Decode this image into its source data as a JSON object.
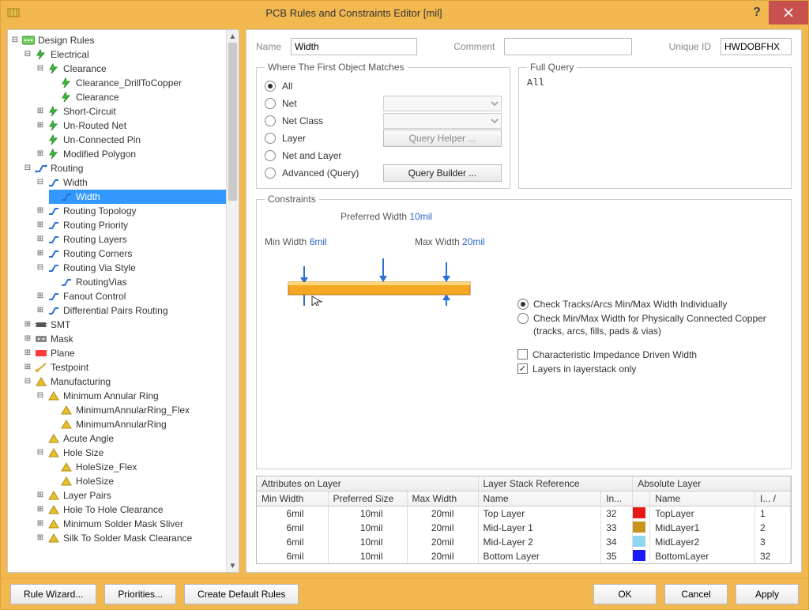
{
  "window": {
    "title": "PCB Rules and Constraints Editor [mil]"
  },
  "tree": {
    "root": "Design Rules",
    "electrical": {
      "label": "Electrical",
      "clearance_group": "Clearance",
      "clearance_drill": "Clearance_DrillToCopper",
      "clearance": "Clearance",
      "short_circuit": "Short-Circuit",
      "unrouted_net": "Un-Routed Net",
      "unconnected_pin": "Un-Connected Pin",
      "modified_polygon": "Modified Polygon"
    },
    "routing": {
      "label": "Routing",
      "width_group": "Width",
      "width": "Width",
      "topology": "Routing Topology",
      "priority": "Routing Priority",
      "layers": "Routing Layers",
      "corners": "Routing Corners",
      "via_style": "Routing Via Style",
      "routing_vias": "RoutingVias",
      "fanout": "Fanout Control",
      "diffpair": "Differential Pairs Routing"
    },
    "smt": "SMT",
    "mask": "Mask",
    "plane": "Plane",
    "testpoint": "Testpoint",
    "manufacturing": {
      "label": "Manufacturing",
      "annular_group": "Minimum Annular Ring",
      "annular_flex": "MinimumAnnularRing_Flex",
      "annular": "MinimumAnnularRing",
      "acute": "Acute Angle",
      "hole_group": "Hole Size",
      "hole_flex": "HoleSize_Flex",
      "hole": "HoleSize",
      "layer_pairs": "Layer Pairs",
      "hole_to_hole": "Hole To Hole Clearance",
      "solder_sliver": "Minimum Solder Mask Sliver",
      "silk_to_solder": "Silk To Solder Mask Clearance"
    }
  },
  "form": {
    "name_label": "Name",
    "name_value": "Width",
    "comment_label": "Comment",
    "comment_value": "",
    "uid_label": "Unique ID",
    "uid_value": "HWDOBFHX"
  },
  "match": {
    "legend": "Where The First Object Matches",
    "all": "All",
    "net": "Net",
    "net_class": "Net Class",
    "layer": "Layer",
    "net_and_layer": "Net and Layer",
    "advanced": "Advanced (Query)",
    "query_helper": "Query Helper ...",
    "query_builder": "Query Builder ..."
  },
  "full_query": {
    "legend": "Full Query",
    "value": "All"
  },
  "constraints": {
    "legend": "Constraints",
    "preferred_label": "Preferred Width",
    "preferred_value": "10mil",
    "min_label": "Min Width",
    "min_value": "6mil",
    "max_label": "Max Width",
    "max_value": "20mil",
    "mode_individual": "Check Tracks/Arcs Min/Max Width Individually",
    "mode_connected": "Check Min/Max Width for Physically Connected Copper (tracks, arcs, fills, pads & vias)",
    "impedance": "Characteristic Impedance Driven Width",
    "layerstack_only": "Layers in layerstack only"
  },
  "layer_table": {
    "attr_header": "Attributes on Layer",
    "stack_header": "Layer Stack Reference",
    "abs_header": "Absolute Layer",
    "cols": {
      "min": "Min Width",
      "pref": "Preferred Size",
      "max": "Max Width",
      "stack_name": "Name",
      "stack_index": "In...",
      "abs_name": "Name",
      "abs_index_hdr": "I...   /"
    },
    "rows": [
      {
        "min": "6mil",
        "pref": "10mil",
        "max": "20mil",
        "stack_name": "Top Layer",
        "stack_index": "32",
        "color": "#e61717",
        "abs_name": "TopLayer",
        "abs_index": "1"
      },
      {
        "min": "6mil",
        "pref": "10mil",
        "max": "20mil",
        "stack_name": "Mid-Layer 1",
        "stack_index": "33",
        "color": "#c9931e",
        "abs_name": "MidLayer1",
        "abs_index": "2"
      },
      {
        "min": "6mil",
        "pref": "10mil",
        "max": "20mil",
        "stack_name": "Mid-Layer 2",
        "stack_index": "34",
        "color": "#8fd6ef",
        "abs_name": "MidLayer2",
        "abs_index": "3"
      },
      {
        "min": "6mil",
        "pref": "10mil",
        "max": "20mil",
        "stack_name": "Bottom Layer",
        "stack_index": "35",
        "color": "#1a1aff",
        "abs_name": "BottomLayer",
        "abs_index": "32"
      }
    ]
  },
  "buttons": {
    "rule_wizard": "Rule Wizard...",
    "priorities": "Priorities...",
    "create_default": "Create Default Rules",
    "ok": "OK",
    "cancel": "Cancel",
    "apply": "Apply"
  }
}
